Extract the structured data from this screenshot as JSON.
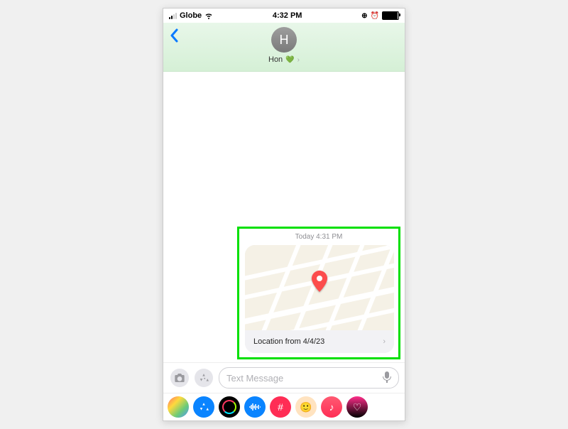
{
  "status": {
    "carrier": "Globe",
    "time": "4:32 PM"
  },
  "header": {
    "avatar_initial": "H",
    "contact_name": "Hon"
  },
  "message": {
    "timestamp_prefix": "Today",
    "timestamp_time": "4:31 PM",
    "location_label": "Location from 4/4/23"
  },
  "compose": {
    "placeholder": "Text Message"
  }
}
